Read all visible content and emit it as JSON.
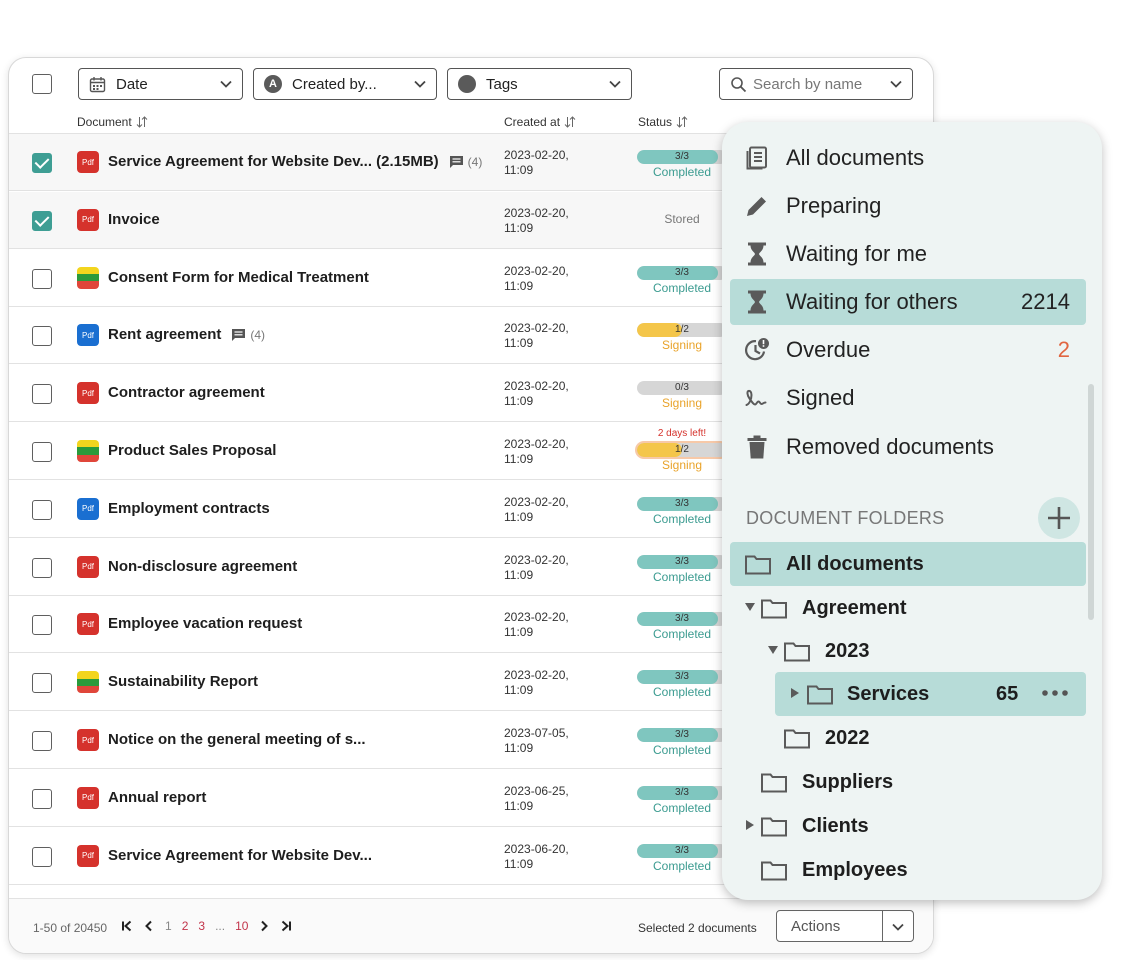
{
  "toolbar": {
    "date_label": "Date",
    "created_by_label": "Created by...",
    "created_by_avatar": "A",
    "tags_label": "Tags",
    "search_placeholder": "Search by name"
  },
  "columns": {
    "document": "Document",
    "created_at": "Created at",
    "status": "Status"
  },
  "rows": [
    {
      "checked": true,
      "icon": "pdf-red",
      "name": "Service Agreement for Website Dev... (2.15MB)",
      "comments": "(4)",
      "date": "2023-02-20,",
      "time": "11:09",
      "progress": "3/3",
      "progress_fraction": 0.9,
      "status": "Completed"
    },
    {
      "checked": true,
      "icon": "pdf-red",
      "name": "Invoice",
      "date": "2023-02-20,",
      "time": "11:09",
      "status": "Stored"
    },
    {
      "checked": false,
      "icon": "flag",
      "name": "Consent Form for Medical Treatment",
      "date": "2023-02-20,",
      "time": "11:09",
      "progress": "3/3",
      "progress_fraction": 0.9,
      "status": "Completed"
    },
    {
      "checked": false,
      "icon": "pdf-blue",
      "name": "Rent agreement",
      "comments": "(4)",
      "date": "2023-02-20,",
      "time": "11:09",
      "progress": "1/2",
      "progress_fraction": 0.5,
      "status": "Signing"
    },
    {
      "checked": false,
      "icon": "pdf-red",
      "name": "Contractor agreement",
      "date": "2023-02-20,",
      "time": "11:09",
      "progress": "0/3",
      "progress_fraction": 0,
      "status": "Signing"
    },
    {
      "checked": false,
      "icon": "flag",
      "name": "Product Sales Proposal",
      "date": "2023-02-20,",
      "time": "11:09",
      "progress": "1/2",
      "progress_fraction": 0.5,
      "status": "Signing",
      "warning": "2 days left!"
    },
    {
      "checked": false,
      "icon": "pdf-blue",
      "name": "Employment contracts",
      "date": "2023-02-20,",
      "time": "11:09",
      "progress": "3/3",
      "progress_fraction": 0.9,
      "status": "Completed"
    },
    {
      "checked": false,
      "icon": "pdf-red",
      "name": "Non-disclosure agreement",
      "date": "2023-02-20,",
      "time": "11:09",
      "progress": "3/3",
      "progress_fraction": 0.9,
      "status": "Completed"
    },
    {
      "checked": false,
      "icon": "pdf-red",
      "name": "Employee vacation request",
      "date": "2023-02-20,",
      "time": "11:09",
      "progress": "3/3",
      "progress_fraction": 0.9,
      "status": "Completed"
    },
    {
      "checked": false,
      "icon": "flag",
      "name": "Sustainability Report",
      "date": "2023-02-20,",
      "time": "11:09",
      "progress": "3/3",
      "progress_fraction": 0.9,
      "status": "Completed"
    },
    {
      "checked": false,
      "icon": "pdf-red",
      "name": "Notice on the general meeting of s...",
      "date": "2023-07-05,",
      "time": "11:09",
      "progress": "3/3",
      "progress_fraction": 0.9,
      "status": "Completed"
    },
    {
      "checked": false,
      "icon": "pdf-red",
      "name": "Annual report",
      "date": "2023-06-25,",
      "time": "11:09",
      "progress": "3/3",
      "progress_fraction": 0.9,
      "status": "Completed"
    },
    {
      "checked": false,
      "icon": "pdf-red",
      "name": "Service Agreement for Website Dev...",
      "date": "2023-06-20,",
      "time": "11:09",
      "progress": "3/3",
      "progress_fraction": 0.9,
      "status": "Completed"
    }
  ],
  "pdf_label": "Pdf",
  "footer": {
    "range": "1-50 of 20450",
    "pages": [
      "1",
      "2",
      "3",
      "...",
      "10"
    ],
    "selected": "Selected 2 documents",
    "actions_label": "Actions"
  },
  "panel": {
    "menu": [
      {
        "label": "All documents",
        "icon": "documents-icon"
      },
      {
        "label": "Preparing",
        "icon": "pencil-icon"
      },
      {
        "label": "Waiting for me",
        "icon": "hourglass-icon"
      },
      {
        "label": "Waiting for others",
        "icon": "hourglass-icon",
        "count": "2214",
        "active": true
      },
      {
        "label": "Overdue",
        "icon": "clock-alert-icon",
        "count": "2"
      },
      {
        "label": "Signed",
        "icon": "signature-icon"
      },
      {
        "label": "Removed documents",
        "icon": "trash-icon"
      }
    ],
    "folders_title": "DOCUMENT FOLDERS",
    "folders": [
      {
        "label": "All documents",
        "active": true
      },
      {
        "label": "Agreement",
        "expanded": true
      },
      {
        "label": "2023",
        "expanded": true
      },
      {
        "label": "Services",
        "count": "65",
        "collapsed": true
      },
      {
        "label": "2022"
      },
      {
        "label": "Suppliers"
      },
      {
        "label": "Clients",
        "collapsed": true
      },
      {
        "label": "Employees"
      }
    ]
  },
  "colors": {
    "teal": "#3e9e94",
    "teal_light": "#b7dcd8",
    "completed_bar": "#7fc6bf",
    "signing_bar": "#f4c64a",
    "pdf_red": "#d5322c",
    "pdf_blue": "#1a6fd1",
    "overdue_count": "#e16540"
  }
}
